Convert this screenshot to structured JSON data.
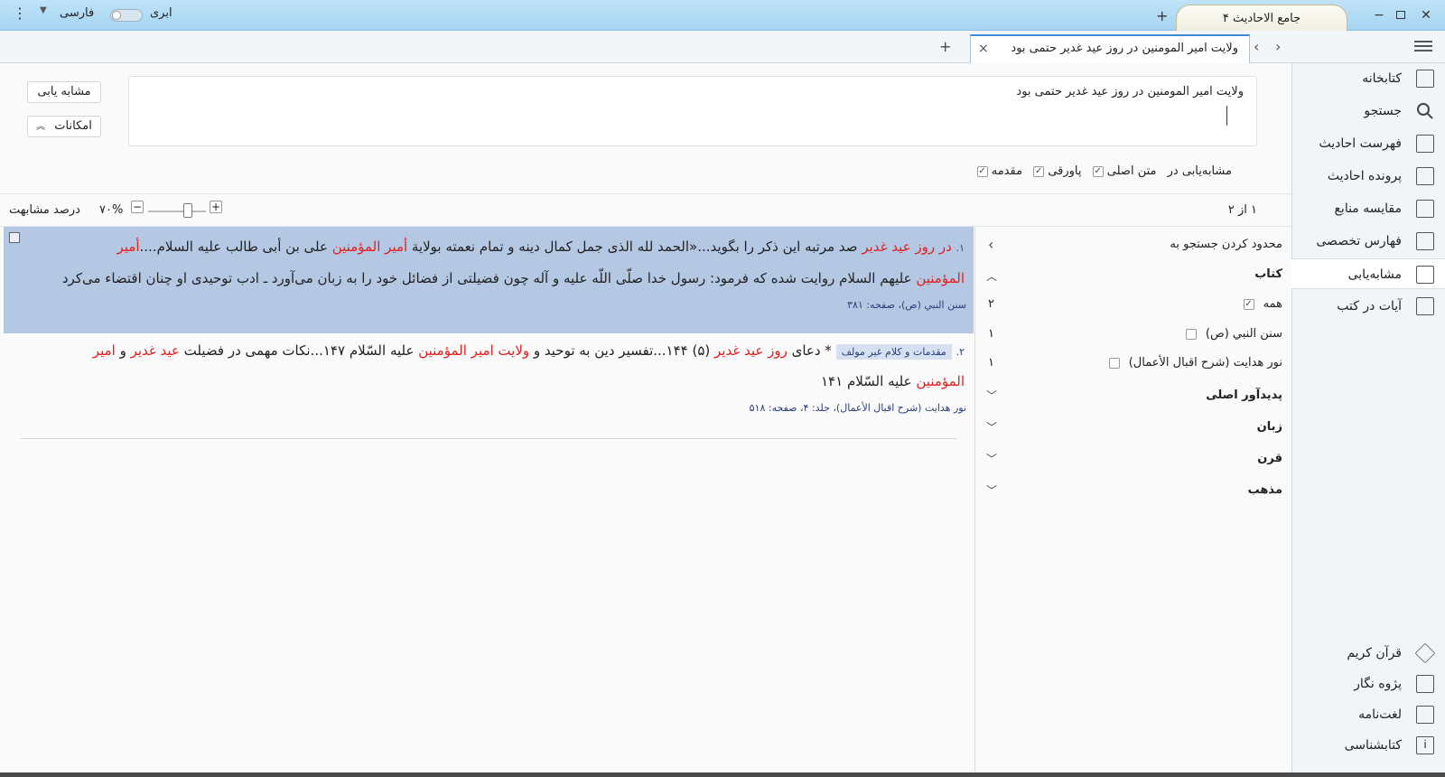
{
  "titlebar": {
    "app_tab": "جامع الاحادیث ۴",
    "language": "فارسی",
    "theme": "ابری",
    "add_tab": "+",
    "minimize": "−",
    "restore": "▫",
    "close": "✕"
  },
  "tabstrip": {
    "doc_tab": "ولایت امیر المومنین در روز عید غدیر حتمی بود",
    "close": "×",
    "add": "+"
  },
  "sidenav": {
    "top_items": [
      "کتابخانه",
      "جستجو",
      "فهرست احادیث",
      "پرونده احادیث",
      "مقایسه منابع",
      "فهارس تخصصی",
      "مشابه‌یابی",
      "آیات در کتب"
    ],
    "active_index": 6,
    "bottom_items": [
      "قرآن کریم",
      "پژوه نگار",
      "لغت‌نامه",
      "کتابشناسی"
    ]
  },
  "query": {
    "text": "ولایت امیر المومنین در روز عید غدیر حتمی بود",
    "similar_button": "مشابه یابی",
    "options_button": "امکانات",
    "options_label": "مشابه‌یابی در",
    "checks": [
      "متن اصلی",
      "پاورقی",
      "مقدمه"
    ]
  },
  "toolbar": {
    "count": "۱ از ۲",
    "similarity_label": "درصد مشابهت",
    "similarity_value": "۷۰%",
    "minus": "−",
    "plus": "+"
  },
  "filter": {
    "title": "محدود کردن جستجو به",
    "book_header": "کتاب",
    "items": [
      {
        "label": "همه",
        "count": "۲",
        "checked": true
      },
      {
        "label": "سنن النبي (ص)",
        "count": "۱",
        "checked": false
      },
      {
        "label": "نور هدایت (شرح اقبال الأعمال)",
        "count": "۱",
        "checked": false
      }
    ],
    "sections": [
      "پدیدآور اصلی",
      "زبان",
      "قرن",
      "مذهب"
    ]
  },
  "results": [
    {
      "num": "۱.",
      "line1": [
        {
          "t": "در روز عید غدیر",
          "h": true
        },
        {
          "t": " صد مرتبه این ذکر را بگوید...«الحمد لله الذی جمل کمال دینه و تمام نعمته بولایة ",
          "h": false
        },
        {
          "t": "أمیر المؤمنین",
          "h": true
        },
        {
          "t": " علی بن أبی طالب علیه السلام....",
          "h": false
        },
        {
          "t": "أمیر",
          "h": true
        }
      ],
      "line2": [
        {
          "t": "المؤمنین",
          "h": true
        },
        {
          "t": " علیهم السلام روایت شده که فرمود: رسول خدا صلّى اللّه علیه و آله چون فضیلتی از فضائل خود را به زبان می‌آورد ـ ادب توحیدی او چنان اقتضاء می‌کرد",
          "h": false
        }
      ],
      "source": "سنن النبي (ص)، صفحه: ۳۸۱"
    },
    {
      "num": "۲.",
      "badge": "مقدمات و کلام غیر مولف",
      "line1": [
        {
          "t": "* دعای ",
          "h": false
        },
        {
          "t": "روز عید غدیر",
          "h": true
        },
        {
          "t": " (۵) ۱۴۴...تفسیر دین به توحید و ",
          "h": false
        },
        {
          "t": "ولایت امیر المؤمنین",
          "h": true
        },
        {
          "t": " علیه السّلام ۱۴۷...نکات مهمی در فضیلت ",
          "h": false
        },
        {
          "t": "عید غدیر",
          "h": true
        },
        {
          "t": " و ",
          "h": false
        },
        {
          "t": "امیر",
          "h": true
        }
      ],
      "line2": [
        {
          "t": "المؤمنین",
          "h": true
        },
        {
          "t": " علیه السّلام ۱۴۱",
          "h": false
        }
      ],
      "source": "نور هدایت (شرح اقبال الأعمال)، جلد: ۴، صفحه: ۵۱۸"
    }
  ]
}
